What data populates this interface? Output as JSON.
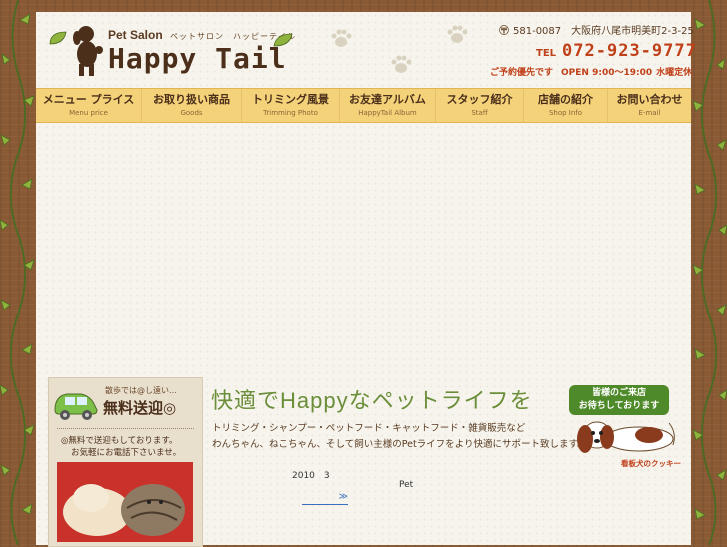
{
  "brand": {
    "small": "Pet Salon",
    "kana": "ペットサロン　ハッピーテイル",
    "name": "Happy Tail"
  },
  "contact": {
    "postal_mark": "〶",
    "address": "581-0087　大阪府八尾市明美町2-3-25",
    "tel_label": "TEL",
    "tel_number": "072-923-9777",
    "reservation": "ご予約優先です",
    "hours": "OPEN 9:00～19:00",
    "closed": "水曜定休"
  },
  "nav": [
    {
      "ja": "メニュー プライス",
      "en": "Menu price"
    },
    {
      "ja": "お取り扱い商品",
      "en": "Goods"
    },
    {
      "ja": "トリミング風景",
      "en": "Trimming Photo"
    },
    {
      "ja": "お友達アルバム",
      "en": "HappyTail Album"
    },
    {
      "ja": "スタッフ紹介",
      "en": "Staff"
    },
    {
      "ja": "店舗の紹介",
      "en": "Shop Info"
    },
    {
      "ja": "お問い合わせ",
      "en": "E-mail"
    }
  ],
  "sidebar": {
    "small": "散歩では@し遠い…",
    "big": "無料送迎◎",
    "note1": "◎無料で送迎もしております。",
    "note2": "お気軽にお電話下さいませ。"
  },
  "main": {
    "title": "快適でHappyなペットライフを",
    "line1": "トリミング・シャンプー・ペットフード・キャットフード・雑貨販売など",
    "line2": "わんちゃん、ねこちゃん、そして飼い主様のPetライフをより快適にサポート致します。"
  },
  "news": {
    "date": "2010　3",
    "item": "Pet",
    "more": "≫"
  },
  "welcome": {
    "badge_line1": "皆様のご来店",
    "badge_line2": "お待ちしております",
    "dog_name": "看板犬のクッキー"
  },
  "colors": {
    "nav_bg": "#f3d27a",
    "accent_red": "#c0401a",
    "title_green": "#6b8e3a",
    "brown": "#4b2f1a"
  }
}
